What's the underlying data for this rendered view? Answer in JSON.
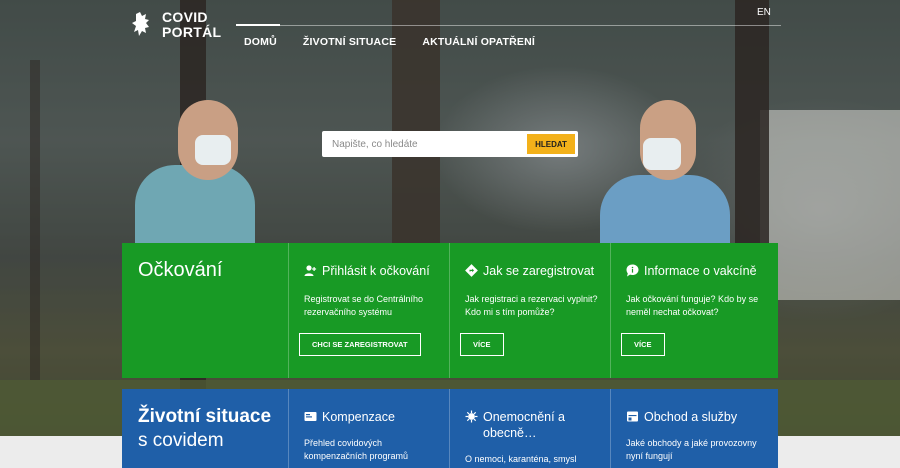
{
  "header": {
    "logo_line1": "COVID",
    "logo_line2": "PORTÁL",
    "nav": [
      {
        "label": "DOMŮ"
      },
      {
        "label": "ŽIVOTNÍ SITUACE"
      },
      {
        "label": "AKTUÁLNÍ OPATŘENÍ"
      }
    ],
    "language": "EN"
  },
  "search": {
    "placeholder": "Napište, co hledáte",
    "button_label": "HLEDAT"
  },
  "vaccination": {
    "title": "Očkování",
    "color": "#189a25",
    "columns": [
      {
        "icon": "user-plus-icon",
        "title": "Přihlásit k očkování",
        "text": "Registrovat se do Centrálního rezervačního systému",
        "button": "CHCI SE ZAREGISTROVAT"
      },
      {
        "icon": "direction-sign-icon",
        "title": "Jak se zaregistrovat",
        "text": "Jak registraci a rezervaci vyplnit? Kdo mi s tím pomůže?",
        "button": "VÍCE"
      },
      {
        "icon": "chat-info-icon",
        "title": "Informace o vakcíně",
        "text": "Jak očkování funguje? Kdo by se neměl nechat očkovat?",
        "button": "VÍCE"
      }
    ]
  },
  "life_situations": {
    "title": "Životní situace",
    "subtitle": "s covidem",
    "color": "#1f5fa8",
    "columns": [
      {
        "icon": "card-icon",
        "title": "Kompenzace",
        "text": "Přehled covidových kompenzačních programů"
      },
      {
        "icon": "virus-icon",
        "title": "Onemocnění a obecně…",
        "text": "O nemoci, karanténa, smysl"
      },
      {
        "icon": "shop-icon",
        "title": "Obchod a služby",
        "text": "Jaké obchody a jaké provozovny nyní fungují"
      }
    ]
  },
  "colors": {
    "accent": "#f3b11a"
  }
}
